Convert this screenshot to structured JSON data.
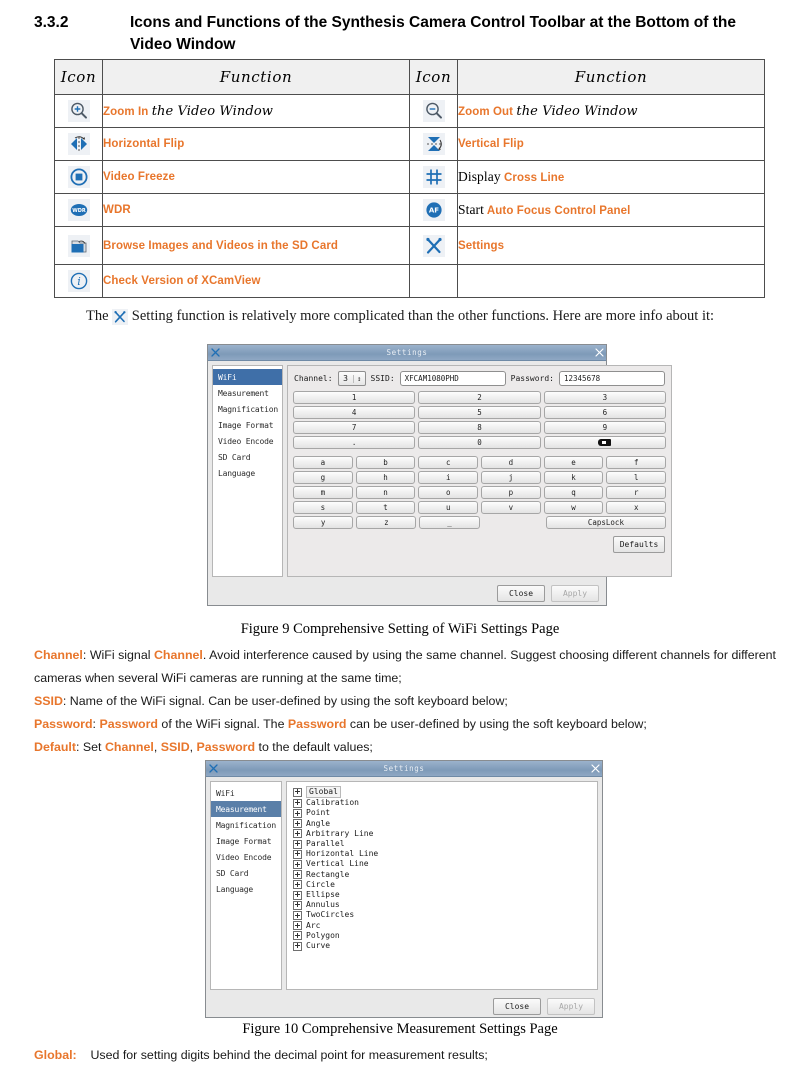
{
  "heading": {
    "number": "3.3.2",
    "text": "Icons and Functions of the Synthesis Camera Control Toolbar at the Bottom of the Video Window"
  },
  "icon_table": {
    "headers": [
      "Icon",
      "Function",
      "Icon",
      "Function"
    ],
    "rows": [
      {
        "left_icon": "zoom-in-icon",
        "left_label_orange": "Zoom In",
        "left_label_hand": "the Video Window",
        "right_icon": "zoom-out-icon",
        "right_label_orange": "Zoom Out",
        "right_label_hand": "the Video Window"
      },
      {
        "left_icon": "horizontal-flip-icon",
        "left_label_orange": "Horizontal Flip",
        "left_label_hand": "",
        "right_icon": "vertical-flip-icon",
        "right_label_orange": "Vertical Flip",
        "right_label_hand": ""
      },
      {
        "left_icon": "video-freeze-icon",
        "left_label_orange": "Video Freeze",
        "left_label_hand": "",
        "right_icon": "cross-line-icon",
        "right_label_plain": "Display",
        "right_label_orange": "Cross Line"
      },
      {
        "left_icon": "wdr-icon",
        "left_label_orange": "WDR",
        "right_icon": "auto-focus-icon",
        "right_label_plain": "Start",
        "right_label_orange": "Auto Focus Control Panel"
      },
      {
        "left_icon": "sd-card-browse-icon",
        "left_label_orange": "Browse Images and Videos in the SD Card",
        "right_icon": "settings-icon",
        "right_label_orange": "Settings"
      },
      {
        "left_icon": "info-icon",
        "left_label_orange": "Check Version of XCamView",
        "right_icon": "",
        "right_label_orange": ""
      }
    ]
  },
  "intro_paragraph": {
    "before_icon": "The",
    "icon": "settings-icon",
    "after_icon": "Setting function is relatively more complicated than the other functions. Here are more info about it:"
  },
  "wifi_dialog": {
    "title": "Settings",
    "close_glyph": "✕",
    "sidebar": [
      "WiFi",
      "Measurement",
      "Magnification",
      "Image Format",
      "Video Encode",
      "SD Card",
      "Language"
    ],
    "selected_sidebar": "WiFi",
    "fields": {
      "channel_label": "Channel:",
      "channel_value": "3",
      "ssid_label": "SSID:",
      "ssid_value": "XFCAM1080PHD",
      "password_label": "Password:",
      "password_value": "12345678"
    },
    "numpad": [
      [
        "1",
        "2",
        "3"
      ],
      [
        "4",
        "5",
        "6"
      ],
      [
        "7",
        "8",
        "9"
      ],
      [
        ".",
        "0",
        "BACKSPACE"
      ]
    ],
    "alphapad": [
      [
        "a",
        "b",
        "c",
        "d",
        "e",
        "f"
      ],
      [
        "g",
        "h",
        "i",
        "j",
        "k",
        "l"
      ],
      [
        "m",
        "n",
        "o",
        "p",
        "q",
        "r"
      ],
      [
        "s",
        "t",
        "u",
        "v",
        "w",
        "x"
      ],
      [
        "y",
        "z",
        "_",
        "CapsLock"
      ]
    ],
    "capslock_label": "CapsLock",
    "defaults_label": "Defaults",
    "close_label": "Close",
    "apply_label": "Apply"
  },
  "figure9_caption": "Figure 9 Comprehensive Setting of WiFi Settings Page",
  "wifi_notes": [
    {
      "term": "Channel",
      "segments": [
        {
          "t": ": WiFi signal ",
          "o": false
        },
        {
          "t": "Channel",
          "o": true
        },
        {
          "t": ". Avoid interference caused by using the same channel. Suggest choosing different channels for different cameras when several WiFi cameras are running at the same time;",
          "o": false
        }
      ]
    },
    {
      "term": "SSID",
      "segments": [
        {
          "t": ": Name of the WiFi signal. Can be user-defined by using the soft keyboard below;",
          "o": false
        }
      ]
    },
    {
      "term": "Password",
      "segments": [
        {
          "t": ": ",
          "o": false
        },
        {
          "t": "Password",
          "o": true
        },
        {
          "t": " of the WiFi signal. The ",
          "o": false
        },
        {
          "t": "Password",
          "o": true
        },
        {
          "t": " can be user-defined by using the soft keyboard below;",
          "o": false
        }
      ]
    },
    {
      "term": "Default",
      "segments": [
        {
          "t": ": Set ",
          "o": false
        },
        {
          "t": "Channel",
          "o": true
        },
        {
          "t": ", ",
          "o": false
        },
        {
          "t": "SSID",
          "o": true
        },
        {
          "t": ", ",
          "o": false
        },
        {
          "t": "Password",
          "o": true
        },
        {
          "t": " to the default values;",
          "o": false
        }
      ]
    }
  ],
  "measurement_dialog": {
    "title": "Settings",
    "close_glyph": "✕",
    "sidebar": [
      "WiFi",
      "Measurement",
      "Magnification",
      "Image Format",
      "Video Encode",
      "SD Card",
      "Language"
    ],
    "selected_sidebar": "Measurement",
    "tree_items": [
      "Global",
      "Calibration",
      "Point",
      "Angle",
      "Arbitrary Line",
      "Parallel",
      "Horizontal Line",
      "Vertical Line",
      "Rectangle",
      "Circle",
      "Ellipse",
      "Annulus",
      "TwoCircles",
      "Arc",
      "Polygon",
      "Curve"
    ],
    "close_label": "Close",
    "apply_label": "Apply"
  },
  "figure10_caption": "Figure 10 Comprehensive Measurement Settings Page",
  "measurement_notes": [
    {
      "term": "Global:",
      "text": "Used for setting digits behind the decimal point for measurement results;"
    }
  ],
  "colors": {
    "orange": "#E8762C",
    "icon_blue": "#1F6FB5",
    "title_bar": "#8fa8c4",
    "selection_blue": "#3f6fa8"
  }
}
